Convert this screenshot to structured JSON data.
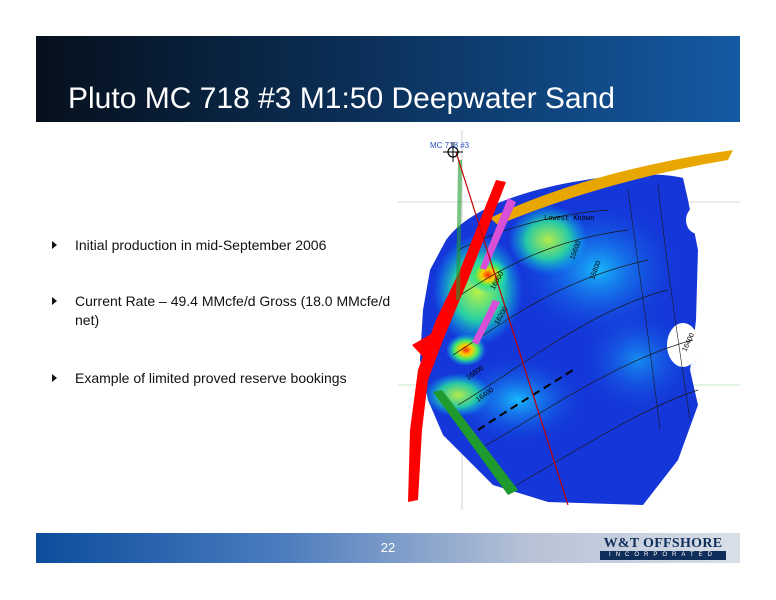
{
  "slide": {
    "title": "Pluto MC 718 #3 M1:50 Deepwater Sand",
    "page_number": "22"
  },
  "bullets": [
    {
      "text": "Initial production in mid-September 2006"
    },
    {
      "text": "Current Rate – 49.4 MMcfe/d Gross (18.0 MMcfe/d net)"
    },
    {
      "text": "Example of limited proved reserve bookings"
    }
  ],
  "map": {
    "labels": {
      "top_well": "MC 718 #3",
      "fault": "Lowest Known",
      "contour_a": "16800",
      "contour_b": "16400",
      "contour_c": "16200",
      "contour_d": "16000",
      "contour_e": "15800",
      "contour_f": "15600",
      "contour_g": "16400"
    }
  },
  "logo": {
    "name": "W&T OFFSHORE",
    "sub": "INCORPORATED"
  },
  "colors": {
    "title_bar_dark": "#06101c",
    "title_bar_light": "#145aa4",
    "footer_blue": "#0b4d9c",
    "logo_navy": "#0f2e5a"
  }
}
